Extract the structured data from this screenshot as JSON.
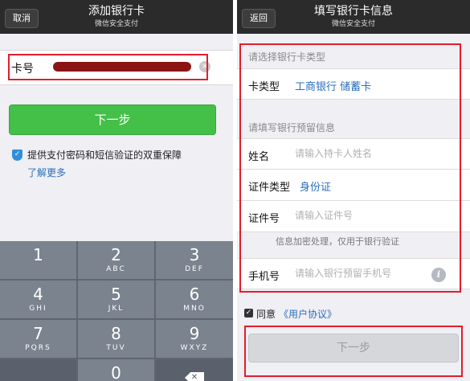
{
  "left": {
    "nav": {
      "cancel_label": "取消",
      "title": "添加银行卡",
      "subtitle": "微信安全支付"
    },
    "card": {
      "label": "卡号",
      "clear_glyph": "×"
    },
    "next_label": "下一步",
    "secure_text": "提供支付密码和短信验证的双重保障",
    "learn_more": "了解更多",
    "keypad": [
      {
        "num": "1",
        "letters": ""
      },
      {
        "num": "2",
        "letters": "ABC"
      },
      {
        "num": "3",
        "letters": "DEF"
      },
      {
        "num": "4",
        "letters": "GHI"
      },
      {
        "num": "5",
        "letters": "JKL"
      },
      {
        "num": "6",
        "letters": "MNO"
      },
      {
        "num": "7",
        "letters": "PQRS"
      },
      {
        "num": "8",
        "letters": "TUV"
      },
      {
        "num": "9",
        "letters": "WXYZ"
      },
      {
        "num": "0",
        "letters": ""
      }
    ],
    "icons": {
      "delete": "backspace-icon",
      "shield": "shield-icon"
    }
  },
  "right": {
    "nav": {
      "back_label": "返回",
      "title": "填写银行卡信息",
      "subtitle": "微信安全支付"
    },
    "section_card_type": "请选择银行卡类型",
    "card_type": {
      "label": "卡类型",
      "value": "工商银行 储蓄卡"
    },
    "section_reserved": "请填写银行预留信息",
    "name": {
      "label": "姓名",
      "placeholder": "请输入持卡人姓名"
    },
    "id_type": {
      "label": "证件类型",
      "value": "身份证"
    },
    "id_number": {
      "label": "证件号",
      "placeholder": "请输入证件号"
    },
    "encrypt_note": "信息加密处理，仅用于银行验证",
    "phone": {
      "label": "手机号",
      "placeholder": "请输入银行预留手机号",
      "info_glyph": "i"
    },
    "agree": {
      "checked": true,
      "text": "同意",
      "link": "《用户协议》"
    },
    "next_label": "下一步"
  },
  "colors": {
    "nav_bg": "#2b2b2b",
    "green_button": "#44bf48",
    "link_blue": "#2a6fbd",
    "highlight_red": "#e41d2d",
    "card_mask": "#8c1414",
    "keypad_bg": "#7b838f"
  }
}
